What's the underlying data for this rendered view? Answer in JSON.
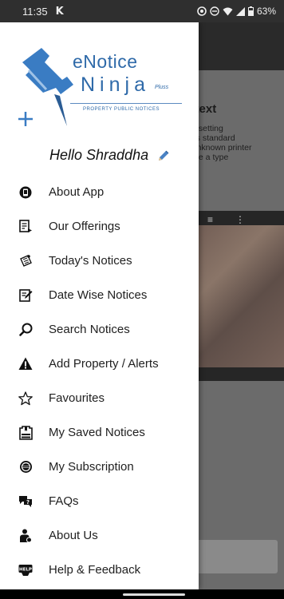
{
  "status_bar": {
    "time": "11:35",
    "carrier_icon": "K",
    "battery": "63%"
  },
  "background": {
    "title": "y text",
    "paragraph": "ypesetting\ntry's standard\nn unknown printer\nnake a type"
  },
  "logo": {
    "line1": "eNotice",
    "line2": "Ninja",
    "pluss": "Pluss",
    "subtitle": "PROPERTY PUBLIC NOTICES"
  },
  "greeting": "Hello Shraddha",
  "menu": [
    {
      "label": "About App",
      "icon": "about-app-icon"
    },
    {
      "label": "Our Offerings",
      "icon": "offerings-icon"
    },
    {
      "label": "Today's Notices",
      "icon": "todays-notices-icon"
    },
    {
      "label": "Date Wise Notices",
      "icon": "date-wise-icon"
    },
    {
      "label": "Search Notices",
      "icon": "search-icon"
    },
    {
      "label": "Add Property / Alerts",
      "icon": "alert-icon"
    },
    {
      "label": "Favourites",
      "icon": "star-icon"
    },
    {
      "label": "My Saved Notices",
      "icon": "saved-icon"
    },
    {
      "label": "My Subscription",
      "icon": "subscription-icon"
    },
    {
      "label": "FAQs",
      "icon": "faq-icon"
    },
    {
      "label": "About Us",
      "icon": "about-us-icon"
    },
    {
      "label": "Help & Feedback",
      "icon": "help-icon"
    }
  ],
  "colors": {
    "brand_blue": "#2f6aa9",
    "pin_blue": "#3a7cc3",
    "edit_pencil": "#4a82c4"
  }
}
